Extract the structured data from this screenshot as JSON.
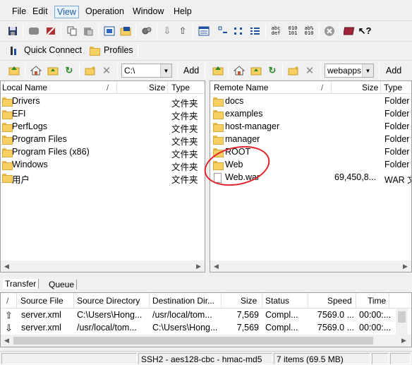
{
  "menu": {
    "items": [
      "File",
      "Edit",
      "View",
      "Operation",
      "Window",
      "Help"
    ],
    "active_index": 2
  },
  "toolbar2": {
    "quick_connect": "Quick Connect",
    "profiles": "Profiles"
  },
  "local": {
    "path": "C:\\",
    "add_label": "Add",
    "columns": {
      "name": "Local Name",
      "size": "Size",
      "type": "Type"
    },
    "rows": [
      {
        "name": "Drivers",
        "type": "文件夹"
      },
      {
        "name": "EFI",
        "type": "文件夹"
      },
      {
        "name": "PerfLogs",
        "type": "文件夹"
      },
      {
        "name": "Program Files",
        "type": "文件夹"
      },
      {
        "name": "Program Files (x86)",
        "type": "文件夹"
      },
      {
        "name": "Windows",
        "type": "文件夹"
      },
      {
        "name": "用户",
        "type": "文件夹"
      }
    ]
  },
  "remote": {
    "path": "webapps",
    "add_label": "Add",
    "columns": {
      "name": "Remote Name",
      "size": "Size",
      "type": "Type"
    },
    "rows": [
      {
        "name": "docs",
        "size": "",
        "type": "Folder"
      },
      {
        "name": "examples",
        "size": "",
        "type": "Folder"
      },
      {
        "name": "host-manager",
        "size": "",
        "type": "Folder"
      },
      {
        "name": "manager",
        "size": "",
        "type": "Folder"
      },
      {
        "name": "ROOT",
        "size": "",
        "type": "Folder"
      },
      {
        "name": "Web",
        "size": "",
        "type": "Folder"
      },
      {
        "name": "Web.war",
        "size": "69,450,8...",
        "type": "WAR 文"
      }
    ],
    "highlight_color": "#e0252b"
  },
  "transfer": {
    "tabs": [
      "Transfer",
      "Queue"
    ],
    "columns": {
      "source_file": "Source File",
      "source_dir": "Source Directory",
      "dest_dir": "Destination Dir...",
      "size": "Size",
      "status": "Status",
      "speed": "Speed",
      "time": "Time"
    },
    "rows": [
      {
        "direction": "upload",
        "arrow": "⇧",
        "source_file": "server.xml",
        "source_dir": "C:\\Users\\Hong...",
        "dest_dir": "/usr/local/tom...",
        "size": "7,569",
        "status": "Compl...",
        "speed": "7569.0 ...",
        "time": "00:00:..."
      },
      {
        "direction": "download",
        "arrow": "⇩",
        "source_file": "server.xml",
        "source_dir": "/usr/local/tom...",
        "dest_dir": "C:\\Users\\Hong...",
        "size": "7,569",
        "status": "Compl...",
        "speed": "7569.0 ...",
        "time": "00:00:..."
      }
    ]
  },
  "status": {
    "cipher": "SSH2 - aes128-cbc - hmac-md5",
    "items": "7 items (69.5 MB)"
  }
}
